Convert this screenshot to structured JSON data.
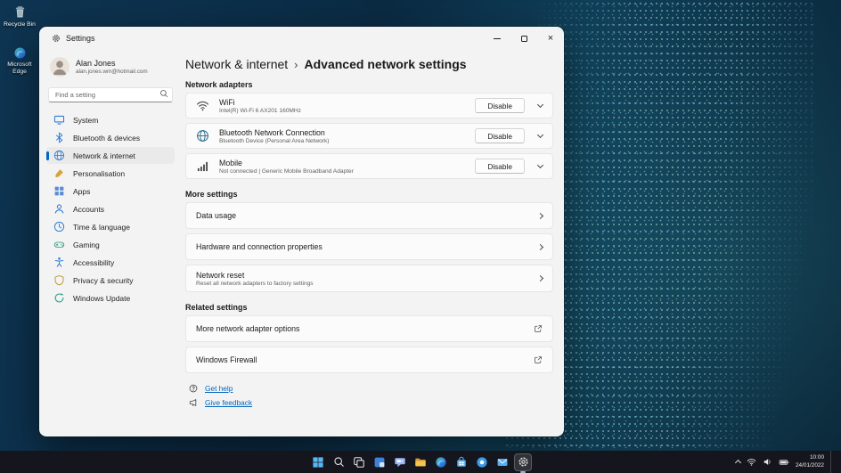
{
  "desktop": {
    "icons": [
      {
        "label": "Recycle Bin"
      },
      {
        "label": "Microsoft Edge"
      }
    ]
  },
  "glyphs": {
    "close": "×"
  },
  "settings_window": {
    "title": "Settings",
    "profile": {
      "name": "Alan Jones",
      "email": "alan.jones.wm@hotmail.com"
    },
    "search": {
      "placeholder": "Find a setting"
    },
    "nav": [
      {
        "label": "System"
      },
      {
        "label": "Bluetooth & devices"
      },
      {
        "label": "Network & internet",
        "selected": true
      },
      {
        "label": "Personalisation"
      },
      {
        "label": "Apps"
      },
      {
        "label": "Accounts"
      },
      {
        "label": "Time & language"
      },
      {
        "label": "Gaming"
      },
      {
        "label": "Accessibility"
      },
      {
        "label": "Privacy & security"
      },
      {
        "label": "Windows Update"
      }
    ],
    "breadcrumb": {
      "parent": "Network & internet",
      "separator": "›",
      "current": "Advanced network settings"
    },
    "network_adapters": {
      "heading": "Network adapters",
      "items": [
        {
          "title": "WiFi",
          "subtitle": "Intel(R) Wi-Fi 6 AX201 160MHz",
          "button": "Disable"
        },
        {
          "title": "Bluetooth Network Connection",
          "subtitle": "Bluetooth Device (Personal Area Network)",
          "button": "Disable"
        },
        {
          "title": "Mobile",
          "subtitle": "Not connected | Generic Mobile Broadband Adapter",
          "button": "Disable"
        }
      ]
    },
    "more_settings": {
      "heading": "More settings",
      "items": [
        {
          "title": "Data usage"
        },
        {
          "title": "Hardware and connection properties"
        },
        {
          "title": "Network reset",
          "subtitle": "Reset all network adapters to factory settings"
        }
      ]
    },
    "related_settings": {
      "heading": "Related settings",
      "items": [
        {
          "title": "More network adapter options"
        },
        {
          "title": "Windows Firewall"
        }
      ]
    },
    "footer_links": [
      {
        "label": "Get help"
      },
      {
        "label": "Give feedback"
      }
    ]
  },
  "taskbar": {
    "icons": [
      "start",
      "search",
      "task-view",
      "widgets",
      "chat",
      "file-explorer",
      "edge",
      "microsoft-store",
      "photos",
      "mail",
      "settings"
    ],
    "active_icon": "settings",
    "tray": {
      "time": "10:00",
      "date": "24/01/2022"
    }
  }
}
